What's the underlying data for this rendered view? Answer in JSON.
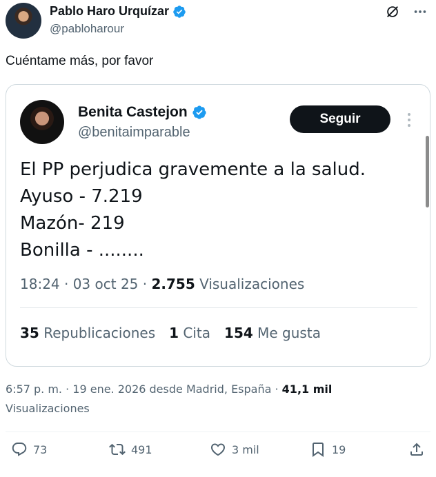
{
  "author": {
    "name": "Pablo Haro Urquízar",
    "handle": "@pabloharour"
  },
  "tweet_text": "Cuéntame más, por favor",
  "quote": {
    "name": "Benita Castejon",
    "handle": "@benitaimparable",
    "follow_label": "Seguir",
    "lines": [
      "El PP perjudica gravemente a la salud.",
      "Ayuso - 7.219",
      "Mazón- 219",
      "Bonilla - ........"
    ],
    "time": "18:24 · 03 oct 25 · ",
    "views_count": "2.755",
    "views_label": " Visualizaciones",
    "reposts_count": "35",
    "reposts_label": " Republicaciones",
    "quotes_count": "1",
    "quotes_label": " Cita",
    "likes_count": "154",
    "likes_label": " Me gusta"
  },
  "post_meta": {
    "time": "6:57 p. m. · 19 ene. 2026 desde Madrid, España · ",
    "views_count": "41,1 mil",
    "views_label": "Visualizaciones"
  },
  "actions": {
    "replies": "73",
    "reposts": "491",
    "likes": "3 mil",
    "bookmarks": "19"
  },
  "colors": {
    "verified": "#1d9bf0",
    "text": "#0f1419",
    "secondary": "#536471"
  },
  "icons": [
    "verified-badge-icon",
    "grok-icon",
    "more-icon",
    "reply-icon",
    "repost-icon",
    "like-icon",
    "bookmark-icon",
    "share-icon"
  ]
}
